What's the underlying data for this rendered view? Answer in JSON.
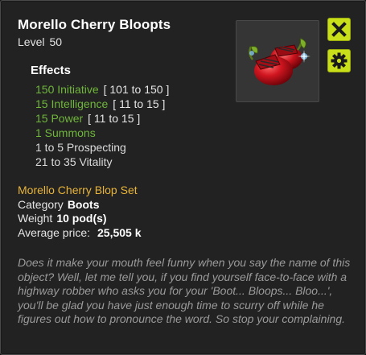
{
  "item": {
    "name": "Morello Cherry Bloopts",
    "level_label": "Level",
    "level_value": "50"
  },
  "effects": {
    "title": "Effects",
    "list": [
      {
        "text": "150 Initiative",
        "range": "[ 101 to 150 ]",
        "color": "#6fb63b"
      },
      {
        "text": "15 Intelligence",
        "range": "[ 11 to 15 ]",
        "color": "#6fb63b"
      },
      {
        "text": "15 Power",
        "range": "[ 11 to 15 ]",
        "color": "#6fb63b"
      },
      {
        "text": "1 Summons",
        "range": "",
        "color": "#6fb63b"
      },
      {
        "text": "1 to 5 Prospecting",
        "range": "",
        "color": "#dcdcdc"
      },
      {
        "text": "21 to 35 Vitality",
        "range": "",
        "color": "#dcdcdc"
      }
    ]
  },
  "set": {
    "name": "Morello Cherry Blop Set",
    "color": "#e8b43a"
  },
  "details": {
    "category_label": "Category",
    "category_value": "Boots",
    "weight_label": "Weight",
    "weight_value": "10 pod(s)",
    "price_label": "Average price:",
    "price_value": "25,505 k"
  },
  "description": "Does it make your mouth feel funny when you say the name of this object? Well, let me tell you, if you find yourself face-to-face with a highway robber who asks you for your 'Boot... Bloops... Bloo...', you'll be glad you have just enough time to scurry off while he figures out how to pronounce the word. So stop your complaining.",
  "buttons": {
    "close_icon": "close-x-icon",
    "settings_icon": "gear-icon",
    "accent": "#c9df1a"
  },
  "item_image": {
    "icon": "cherry-boots-icon"
  }
}
